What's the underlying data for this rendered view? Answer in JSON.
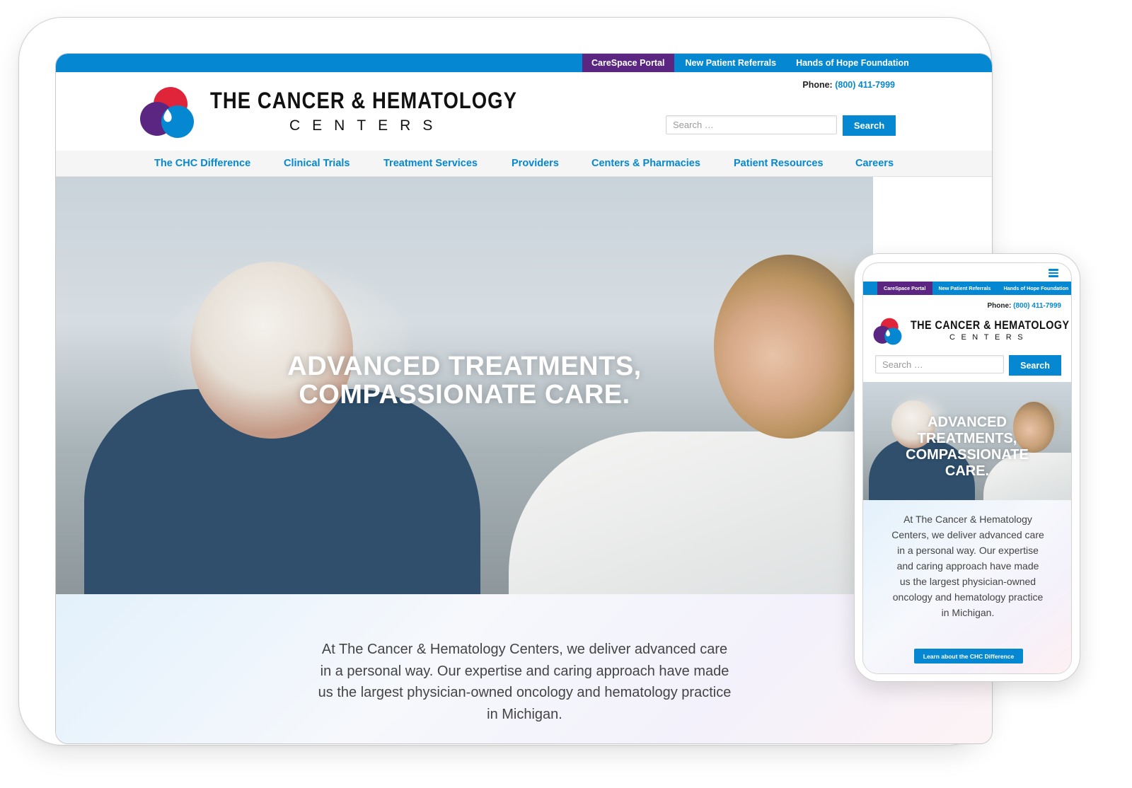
{
  "brand": {
    "name_line1": "THE CANCER & HEMATOLOGY",
    "name_line2": "CENTERS",
    "colors": {
      "primary_blue": "#0588d1",
      "purple": "#5b2682",
      "red": "#e0243a"
    }
  },
  "top_links": [
    {
      "label": "CareSpace Portal",
      "active": true
    },
    {
      "label": "New Patient Referrals",
      "active": false
    },
    {
      "label": "Hands of Hope Foundation",
      "active": false
    }
  ],
  "phone": {
    "label": "Phone:",
    "number": "(800) 411-7999"
  },
  "search": {
    "placeholder": "Search …",
    "button_label": "Search"
  },
  "nav": [
    {
      "label": "The CHC Difference"
    },
    {
      "label": "Clinical Trials"
    },
    {
      "label": "Treatment Services"
    },
    {
      "label": "Providers"
    },
    {
      "label": "Centers & Pharmacies"
    },
    {
      "label": "Patient Resources"
    },
    {
      "label": "Careers"
    }
  ],
  "hero": {
    "title_line1": "ADVANCED TREATMENTS,",
    "title_line2": "COMPASSIONATE CARE.",
    "mobile_title": "ADVANCED TREATMENTS, COMPASSIONATE CARE.",
    "image_alt": "Older man and woman seated outdoors, woman's hand on man's shoulder"
  },
  "intro": {
    "text": "At The Cancer & Hematology Centers, we deliver advanced care in a personal way. Our expertise and caring approach have made us the largest physician-owned oncology and hematology practice in Michigan.",
    "cta_label": "Learn about the CHC Difference"
  },
  "mobile": {
    "menu_icon": "hamburger-menu-icon"
  }
}
